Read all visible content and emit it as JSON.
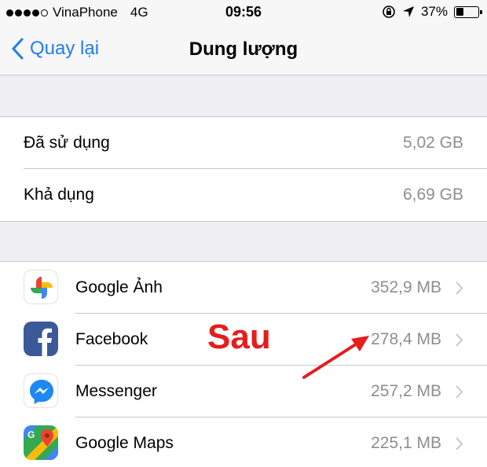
{
  "status_bar": {
    "carrier": "VinaPhone",
    "network": "4G",
    "time": "09:56",
    "battery": "37%",
    "battery_level": 0.37
  },
  "nav": {
    "back_label": "Quay lại",
    "title": "Dung lượng"
  },
  "storage": [
    {
      "label": "Đã sử dụng",
      "value": "5,02 GB"
    },
    {
      "label": "Khả dụng",
      "value": "6,69 GB"
    }
  ],
  "apps": [
    {
      "name": "Google Ảnh",
      "size": "352,9 MB",
      "icon": "google-photos-icon"
    },
    {
      "name": "Facebook",
      "size": "278,4 MB",
      "icon": "facebook-icon"
    },
    {
      "name": "Messenger",
      "size": "257,2 MB",
      "icon": "messenger-icon"
    },
    {
      "name": "Google Maps",
      "size": "225,1 MB",
      "icon": "google-maps-icon"
    }
  ],
  "annotation": {
    "text": "Sau",
    "color": "#e51d1d"
  },
  "colors": {
    "accent": "#1f7cf6",
    "secondary_text": "#8e8e93",
    "background": "#efeff4"
  }
}
